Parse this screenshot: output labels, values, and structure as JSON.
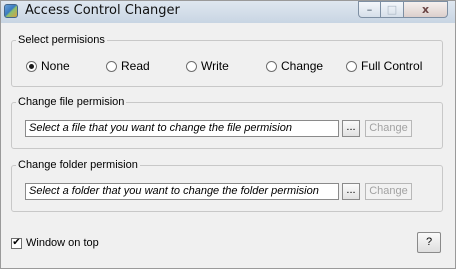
{
  "window": {
    "title": "Access Control Changer",
    "icon": "app-shield-icon",
    "controls": {
      "minimize": "–",
      "maximize": "□",
      "close": "x"
    }
  },
  "permissions": {
    "legend": "Select permisions",
    "selected": "None",
    "options": [
      "None",
      "Read",
      "Write",
      "Change",
      "Full Control"
    ]
  },
  "file_group": {
    "legend": "Change file permision",
    "placeholder": "Select a file that you want to change the file permision",
    "browse_label": "...",
    "change_label": "Change"
  },
  "folder_group": {
    "legend": "Change folder permision",
    "placeholder": "Select a folder that you want to change the folder permision",
    "browse_label": "...",
    "change_label": "Change"
  },
  "footer": {
    "window_on_top_label": "Window on top",
    "window_on_top_checked": true,
    "help_label": "?"
  },
  "colors": {
    "titlebar": "#c8d5e3",
    "client_bg": "#f0f0f0",
    "disabled_text": "#a2a2a2"
  }
}
